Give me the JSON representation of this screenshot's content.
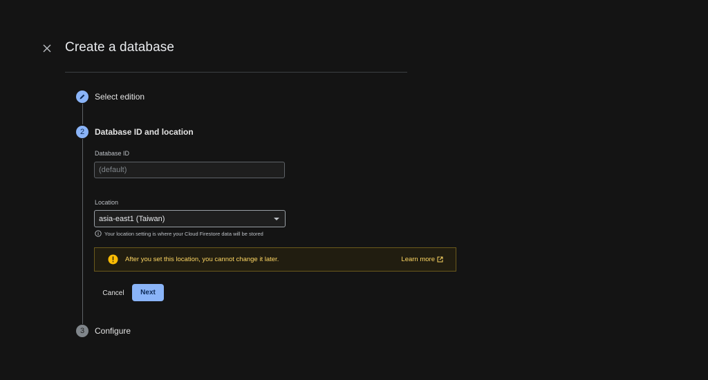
{
  "header": {
    "title": "Create a database",
    "close_icon": "close-icon"
  },
  "steps": [
    {
      "number": "",
      "icon": "edit-pencil-icon",
      "label": "Select edition",
      "state": "completed"
    },
    {
      "number": "2",
      "label": "Database ID and location",
      "state": "active"
    },
    {
      "number": "3",
      "label": "Configure",
      "state": "pending"
    }
  ],
  "form": {
    "database_id": {
      "label": "Database ID",
      "placeholder": "(default)",
      "value": ""
    },
    "location": {
      "label": "Location",
      "selected": "asia-east1 (Taiwan)",
      "hint": "Your location setting is where your Cloud Firestore data will be stored"
    }
  },
  "warning": {
    "text": "After you set this location, you cannot change it later.",
    "link_label": "Learn more",
    "icon": "warning-icon"
  },
  "actions": {
    "cancel_label": "Cancel",
    "next_label": "Next"
  },
  "colors": {
    "background": "#141414",
    "accent": "#8ab4f8",
    "warning": "#fdd663"
  }
}
